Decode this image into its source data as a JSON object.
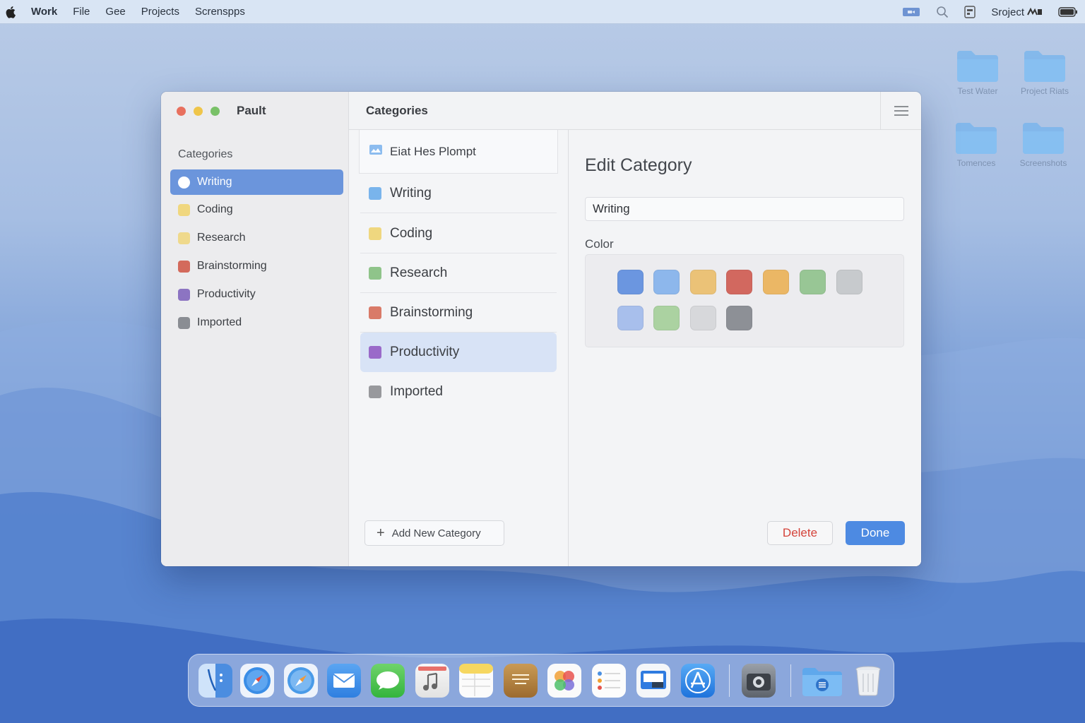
{
  "menubar": {
    "items": [
      "Work",
      "File",
      "Gee",
      "Projects",
      "Screnspps"
    ],
    "right_label": "Sroject"
  },
  "desktop": {
    "icons": [
      {
        "label": "Test Water"
      },
      {
        "label": "Project Riats"
      },
      {
        "label": "Tomences"
      },
      {
        "label": "Screenshots"
      }
    ]
  },
  "window": {
    "title": "Pault",
    "middle_title": "Categories"
  },
  "sidebar": {
    "heading": "Categories",
    "items": [
      {
        "label": "Writing",
        "color": "#ffffff",
        "active": true
      },
      {
        "label": "Coding",
        "color": "#f0d77f"
      },
      {
        "label": "Research",
        "color": "#efd98c"
      },
      {
        "label": "Brainstorming",
        "color": "#d36a5c"
      },
      {
        "label": "Productivity",
        "color": "#8c74c2"
      },
      {
        "label": "Imported",
        "color": "#8a8d93"
      }
    ]
  },
  "list": {
    "prompt_card": "Eiat Hes Plompt",
    "items": [
      {
        "label": "Writing",
        "color": "#79b4ec"
      },
      {
        "label": "Coding",
        "color": "#efd77f"
      },
      {
        "label": "Research",
        "color": "#8fc48a"
      },
      {
        "label": "Brainstorming",
        "color": "#d97a68"
      },
      {
        "label": "Productivity",
        "color": "#9a6ac9",
        "active": true
      },
      {
        "label": "Imported",
        "color": "#98999d"
      }
    ],
    "add_button": "Add New Category"
  },
  "edit": {
    "title": "Edit Category",
    "name_value": "Writing",
    "color_label": "Color",
    "swatches": [
      "#6b96e0",
      "#8db7ec",
      "#ebc277",
      "#d2685f",
      "#ebb765",
      "#98c695",
      "#c7cacd",
      "#a8bfec",
      "#abd2a1",
      "#d7d8db",
      "#8d9096"
    ],
    "delete_label": "Delete",
    "done_label": "Done"
  }
}
